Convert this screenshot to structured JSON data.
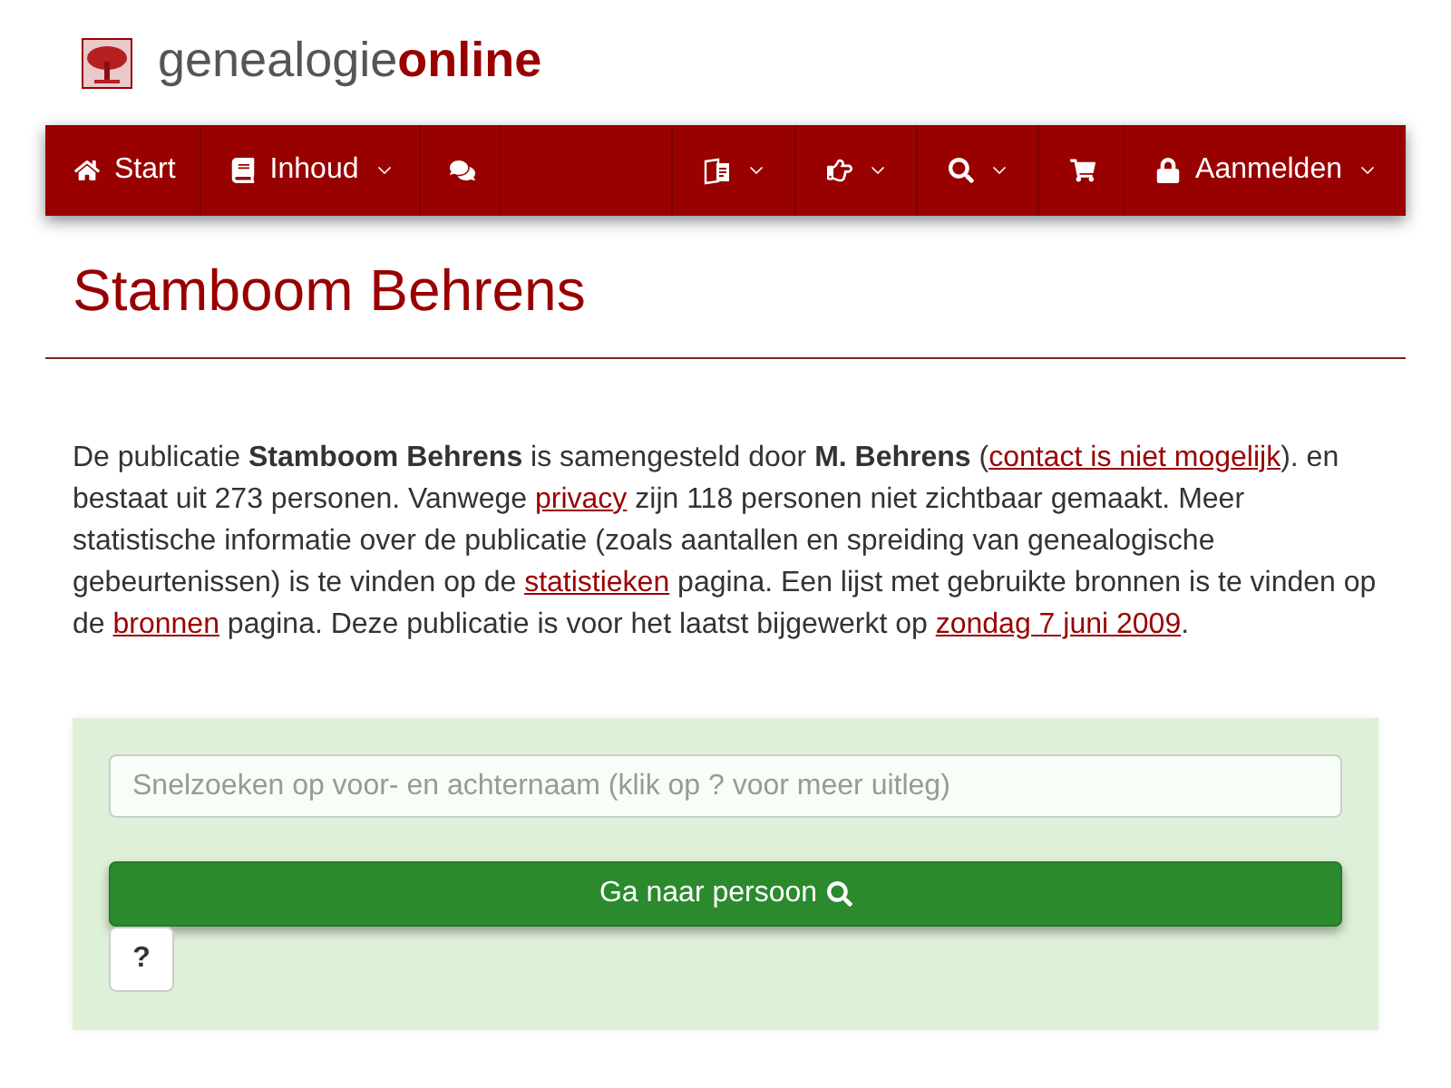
{
  "logo": {
    "text": "genealogie**online**"
  },
  "nav": {
    "left": [
      {
        "label": "Start",
        "has_menu": false
      },
      {
        "label": "Inhoud",
        "has_menu": true
      },
      {
        "has_menu": false
      }
    ],
    "right": [
      {
        "has_menu": true
      },
      {
        "has_menu": true
      },
      {
        "has_menu": true
      },
      {
        "has_menu": false
      },
      {
        "label": "Aanmelden",
        "has_menu": true
      }
    ]
  },
  "heading": "Stamboom Behrens",
  "description": [
    {
      "kind": "text",
      "text": "De publicatie **Stamboom Behrens** is samengesteld door **M. Behrens** ("
    },
    {
      "kind": "link",
      "text": "contact is niet mogelijk"
    },
    {
      "kind": "text",
      "text": "). en bestaat uit 273 personen. Vanwege "
    },
    {
      "kind": "link",
      "text": "privacy"
    },
    {
      "kind": "text",
      "text": " zijn 118 personen niet zichtbaar gemaakt. Meer statistische informatie over de publicatie (zoals aantallen en spreiding van genealogische gebeurtenissen) is te vinden op de "
    },
    {
      "kind": "link",
      "text": "statistieken"
    },
    {
      "kind": "text",
      "text": " pagina. Een lijst met gebruikte bronnen is te vinden op de "
    },
    {
      "kind": "link",
      "text": "bronnen"
    },
    {
      "kind": "text",
      "text": " pagina. Deze publicatie is voor het laatst bijgewerkt op "
    },
    {
      "kind": "link",
      "text": "zondag 7 juni 2009"
    },
    {
      "kind": "text",
      "text": "."
    }
  ],
  "quick_search": {
    "placeholder": "Snelzoeken op voor- en achternaam (klik op ? voor meer uitleg)",
    "submit_label": "Ga naar persoon",
    "help_label": "?"
  }
}
